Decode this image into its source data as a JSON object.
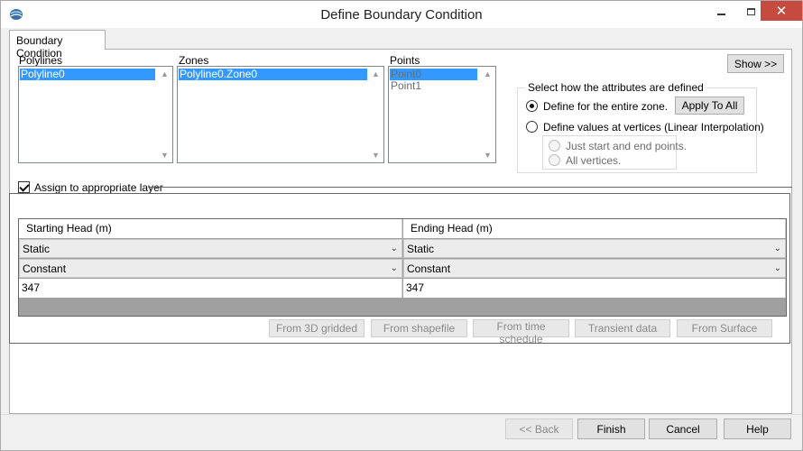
{
  "window": {
    "title": "Define Boundary Condition"
  },
  "tab": {
    "label": "Boundary Condition"
  },
  "polylines": {
    "label": "Polylines",
    "items": [
      "Polyline0"
    ]
  },
  "zones": {
    "label": "Zones",
    "items": [
      "Polyline0.Zone0"
    ]
  },
  "points": {
    "label": "Points",
    "items": [
      "Point0",
      "Point1"
    ]
  },
  "show_button": "Show >>",
  "attributes": {
    "title": "Select how the attributes are defined",
    "option_entire_zone": "Define for the entire zone.",
    "apply_to_all": "Apply To All",
    "option_vertices": "Define values at vertices (Linear Interpolation)",
    "sub_start_end": "Just start and end points.",
    "sub_all_vertices": "All vertices."
  },
  "assign_layer": {
    "label": "Assign to appropriate layer",
    "checked": true
  },
  "grid": {
    "columns": [
      "Starting Head (m)",
      "Ending Head (m)"
    ],
    "rows": [
      [
        "Static",
        "Static"
      ],
      [
        "Constant",
        "Constant"
      ],
      [
        "347",
        "347"
      ]
    ]
  },
  "source_buttons": {
    "from_3d_gridded": "From 3D gridded",
    "from_shapefile": "From shapefile",
    "from_time_schedule": "From time schedule",
    "transient_data": "Transient data",
    "from_surface": "From Surface"
  },
  "footer": {
    "back": "<< Back",
    "finish": "Finish",
    "cancel": "Cancel",
    "help": "Help"
  }
}
